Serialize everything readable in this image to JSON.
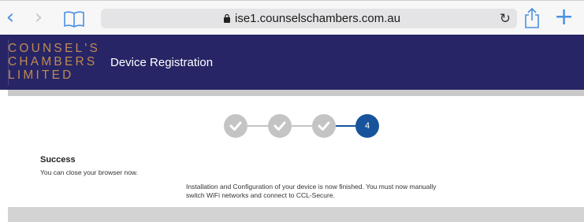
{
  "browser": {
    "url": "ise1.counselschambers.com.au",
    "icons": {
      "back": "chevron-left-icon",
      "forward": "chevron-right-icon",
      "bookmarks": "book-icon",
      "lock": "lock-icon",
      "reload": "reload-icon",
      "share": "share-icon",
      "new_tab": "plus-icon"
    }
  },
  "header": {
    "logo_lines": [
      "COUNSEL'S",
      "CHAMBERS",
      "LIMITED"
    ],
    "title": "Device Registration",
    "background": "#272566",
    "logo_color": "#c08a52"
  },
  "stepper": {
    "steps": [
      {
        "state": "done",
        "icon": "check-icon"
      },
      {
        "state": "done",
        "icon": "check-icon"
      },
      {
        "state": "done",
        "icon": "check-icon"
      },
      {
        "state": "current",
        "label": "4"
      }
    ],
    "active_color": "#17549b"
  },
  "content": {
    "success_title": "Success",
    "success_text": "You can close your browser now.",
    "info_text": "Installation and Configuration of your device is now finished. You must now manually switch WiFi networks and connect to CCL-Secure."
  }
}
